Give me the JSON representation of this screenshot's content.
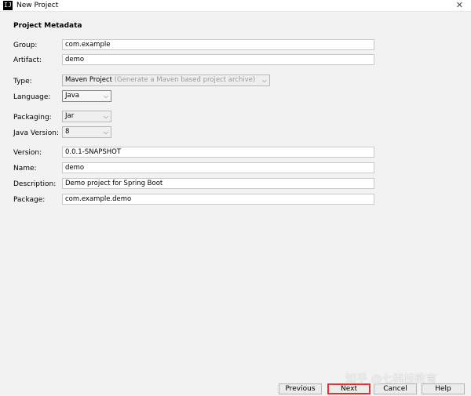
{
  "window": {
    "title": "New Project",
    "app_icon": "IJ"
  },
  "section_title": "Project Metadata",
  "fields": {
    "group": {
      "label": "Group:",
      "value": "com.example"
    },
    "artifact": {
      "label": "Artifact:",
      "value": "demo"
    },
    "type": {
      "label": "Type:",
      "value": "Maven Project",
      "hint": "(Generate a Maven based project archive)"
    },
    "language": {
      "label": "Language:",
      "value": "Java"
    },
    "packaging": {
      "label": "Packaging:",
      "value": "Jar"
    },
    "java_version": {
      "label": "Java Version:",
      "value": "8"
    },
    "version": {
      "label": "Version:",
      "value": "0.0.1-SNAPSHOT"
    },
    "name": {
      "label": "Name:",
      "value": "demo"
    },
    "description": {
      "label": "Description:",
      "value": "Demo project for Spring Boot"
    },
    "package": {
      "label": "Package:",
      "value": "com.example.demo"
    }
  },
  "buttons": {
    "previous": "Previous",
    "next": "Next",
    "cancel": "Cancel",
    "help": "Help"
  },
  "watermark": "知乎 @七科技教育",
  "icons": {
    "close": "close-icon",
    "dropdown": "chevron-down-icon"
  },
  "colors": {
    "next_highlight": "#e23232",
    "focus_border": "#5a8fd6"
  }
}
